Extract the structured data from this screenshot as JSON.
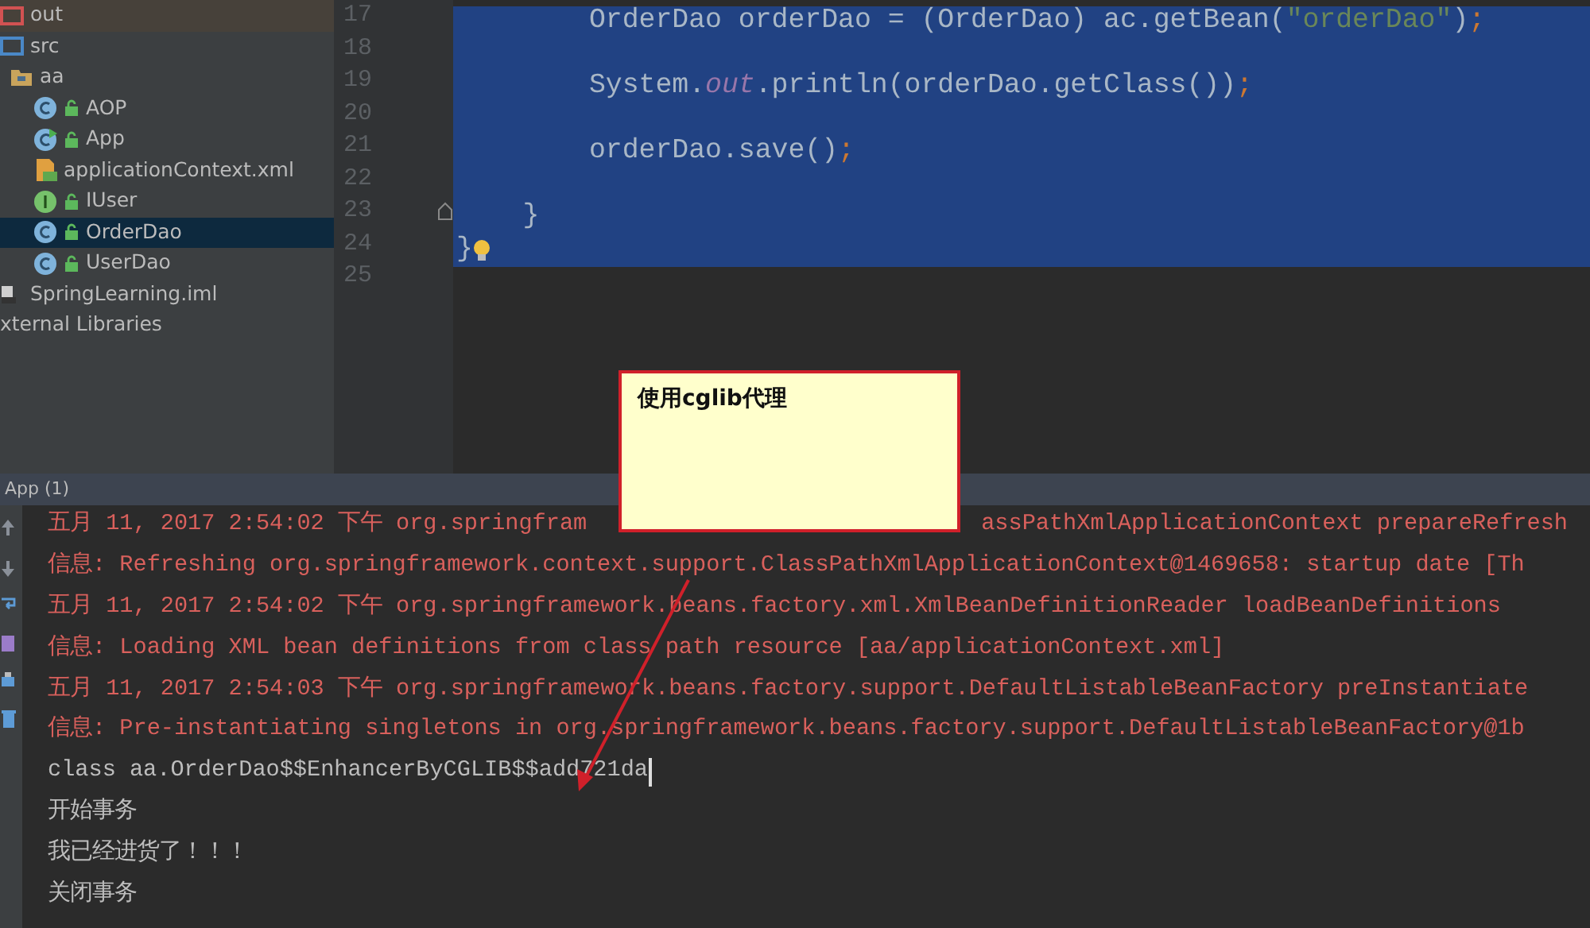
{
  "project_tree": {
    "items": [
      {
        "label": "out",
        "kind": "excluded-folder",
        "selected": false
      },
      {
        "label": "src",
        "kind": "source-folder",
        "selected": false,
        "children": [
          {
            "label": "aa",
            "kind": "package",
            "selected": false,
            "children": [
              {
                "label": "AOP",
                "kind": "class",
                "selected": false
              },
              {
                "label": "App",
                "kind": "runnable-class",
                "selected": false
              },
              {
                "label": "applicationContext.xml",
                "kind": "xml-file",
                "selected": false
              },
              {
                "label": "IUser",
                "kind": "interface",
                "selected": false
              },
              {
                "label": "OrderDao",
                "kind": "class",
                "selected": true
              },
              {
                "label": "UserDao",
                "kind": "class",
                "selected": false
              }
            ]
          }
        ]
      },
      {
        "label": "SpringLearning.iml",
        "kind": "module-file",
        "selected": false
      },
      {
        "label": "xternal Libraries",
        "kind": "libraries",
        "selected": false
      }
    ]
  },
  "editor": {
    "lines": [
      {
        "number": "17",
        "selected": true,
        "kind": "code",
        "tokens": [
          {
            "kind": "plain",
            "text": "        OrderDao orderDao = (OrderDao) ac.getBean("
          },
          {
            "kind": "string",
            "text": "\"orderDao\""
          },
          {
            "kind": "plain",
            "text": ")"
          },
          {
            "kind": "punct",
            "text": ";"
          }
        ]
      },
      {
        "number": "18",
        "selected": true,
        "kind": "code"
      },
      {
        "number": "19",
        "selected": true,
        "kind": "code",
        "tokens": [
          {
            "kind": "plain",
            "text": "        System."
          },
          {
            "kind": "field",
            "text": "out"
          },
          {
            "kind": "plain",
            "text": ".println(orderDao.getClass())"
          },
          {
            "kind": "punct",
            "text": ";"
          }
        ]
      },
      {
        "number": "20",
        "selected": true,
        "kind": "code"
      },
      {
        "number": "21",
        "selected": true,
        "kind": "code",
        "tokens": [
          {
            "kind": "plain",
            "text": "        orderDao.save()"
          },
          {
            "kind": "punct",
            "text": ";"
          }
        ]
      },
      {
        "number": "22",
        "selected": true,
        "kind": "code"
      },
      {
        "number": "23",
        "selected": true,
        "kind": "block-end",
        "tokens": [
          {
            "kind": "plain",
            "text": "    }"
          }
        ]
      },
      {
        "number": "24",
        "selected": true,
        "kind": "hint",
        "tokens": [
          {
            "kind": "plain",
            "text": "}"
          }
        ]
      },
      {
        "number": "25",
        "selected": false,
        "kind": "code"
      }
    ]
  },
  "console": {
    "title": "App (1)",
    "lines": [
      {
        "kind": "log",
        "caret": false,
        "text": "五月 11, 2017 2:54:02 下午 org.springfram",
        "tail": "assPathXmlApplicationContext prepareRefresh"
      },
      {
        "kind": "log",
        "caret": false,
        "text": "信息: Refreshing org.springframework.context.support.ClassPathXmlApplicationContext@1469658: startup date [Th"
      },
      {
        "kind": "log",
        "caret": false,
        "text": "五月 11, 2017 2:54:02 下午 org.springframework.beans.factory.xml.XmlBeanDefinitionReader loadBeanDefinitions"
      },
      {
        "kind": "log",
        "caret": false,
        "text": "信息: Loading XML bean definitions from class path resource [aa/applicationContext.xml]"
      },
      {
        "kind": "log",
        "caret": false,
        "text": "五月 11, 2017 2:54:03 下午 org.springframework.beans.factory.support.DefaultListableBeanFactory preInstantiate"
      },
      {
        "kind": "log",
        "caret": false,
        "text": "信息: Pre-instantiating singletons in org.springframework.beans.factory.support.DefaultListableBeanFactory@1b"
      },
      {
        "kind": "output",
        "caret": true,
        "text": "class aa.OrderDao$$EnhancerByCGLIB$$add721da"
      },
      {
        "kind": "output",
        "caret": false,
        "text": "开始事务"
      },
      {
        "kind": "output",
        "caret": false,
        "text": "我已经进货了！！！"
      },
      {
        "kind": "output",
        "caret": false,
        "text": "关闭事务"
      }
    ]
  },
  "note": {
    "text": "使用cglib代理"
  }
}
